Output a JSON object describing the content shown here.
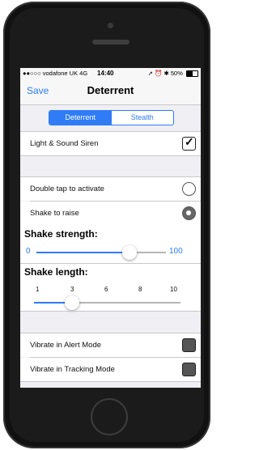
{
  "statusbar": {
    "carrier": "●●○○○ vodafone UK 4G",
    "time": "14:40",
    "status_icons": "➚ ⏰ ✱",
    "battery": "50%",
    "battery_level": 0.5
  },
  "navbar": {
    "save_label": "Save",
    "title": "Deterrent"
  },
  "segments": [
    {
      "label": "Deterrent",
      "selected": true
    },
    {
      "label": "Stealth",
      "selected": false
    }
  ],
  "siren": {
    "label": "Light & Sound Siren",
    "checked": true
  },
  "activation": [
    {
      "label": "Double tap to activate",
      "selected": false
    },
    {
      "label": "Shake to raise",
      "selected": true
    }
  ],
  "shake_strength": {
    "label": "Shake strength:",
    "min": "0",
    "max": "100",
    "value": 72
  },
  "shake_length": {
    "label": "Shake length:",
    "ticks": [
      "1",
      "3",
      "6",
      "8",
      "10"
    ],
    "value": "3"
  },
  "vibrate": [
    {
      "label": "Vibrate in Alert Mode",
      "checked": false
    },
    {
      "label": "Vibrate in Tracking Mode",
      "checked": false
    }
  ],
  "colors": {
    "accent": "#2f7cf6",
    "background": "#efeff4"
  }
}
